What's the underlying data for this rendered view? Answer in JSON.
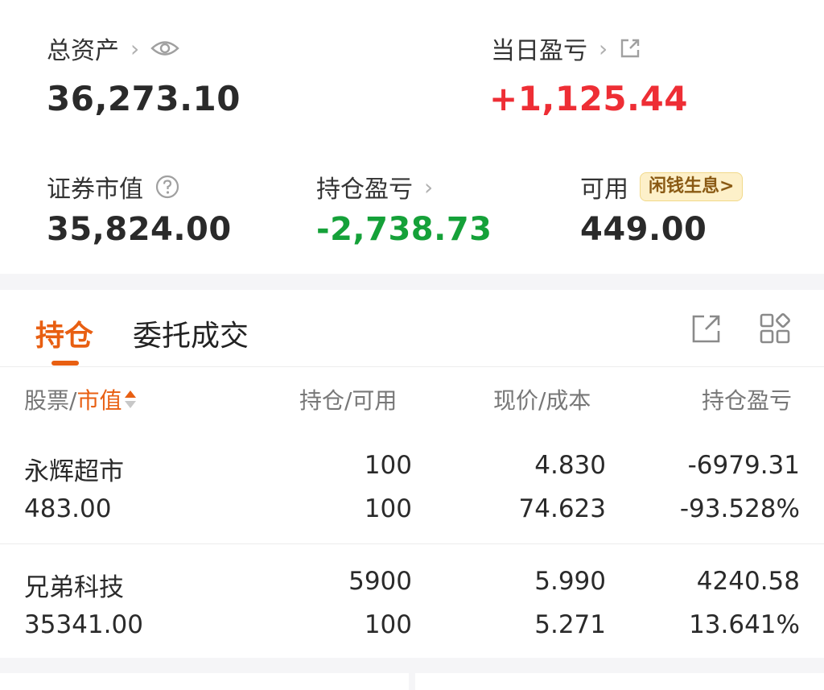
{
  "summary": {
    "total_assets_label": "总资产",
    "total_assets_value": "36,273.10",
    "daily_pnl_label": "当日盈亏",
    "daily_pnl_value": "+1,125.44",
    "market_value_label": "证券市值",
    "market_value_value": "35,824.00",
    "position_pnl_label": "持仓盈亏",
    "position_pnl_value": "-2,738.73",
    "available_label": "可用",
    "available_badge": "闲钱生息>",
    "available_value": "449.00"
  },
  "tabs": [
    {
      "label": "持仓"
    },
    {
      "label": "委托成交"
    }
  ],
  "table": {
    "headers": {
      "stock": "股票",
      "sep": "/",
      "market_value": "市值",
      "position": "持仓/可用",
      "price": "现价/成本",
      "pnl": "持仓盈亏"
    },
    "rows": [
      {
        "name": "永辉超市",
        "market_value": "483.00",
        "position": "100",
        "available": "100",
        "price": "4.830",
        "cost": "74.623",
        "pnl": "-6979.31",
        "pnl_pct": "-93.528%"
      },
      {
        "name": "兄弟科技",
        "market_value": "35341.00",
        "position": "5900",
        "available": "100",
        "price": "5.990",
        "cost": "5.271",
        "pnl": "4240.58",
        "pnl_pct": "13.641%"
      }
    ]
  },
  "colors": {
    "accent": "#e85f12",
    "gain": "#ee2e35",
    "loss": "#15a139"
  },
  "icons": [
    "chevron-right-icon",
    "eye-icon",
    "share-icon",
    "help-icon",
    "external-link-icon",
    "grid-icon",
    "sort-icon"
  ]
}
